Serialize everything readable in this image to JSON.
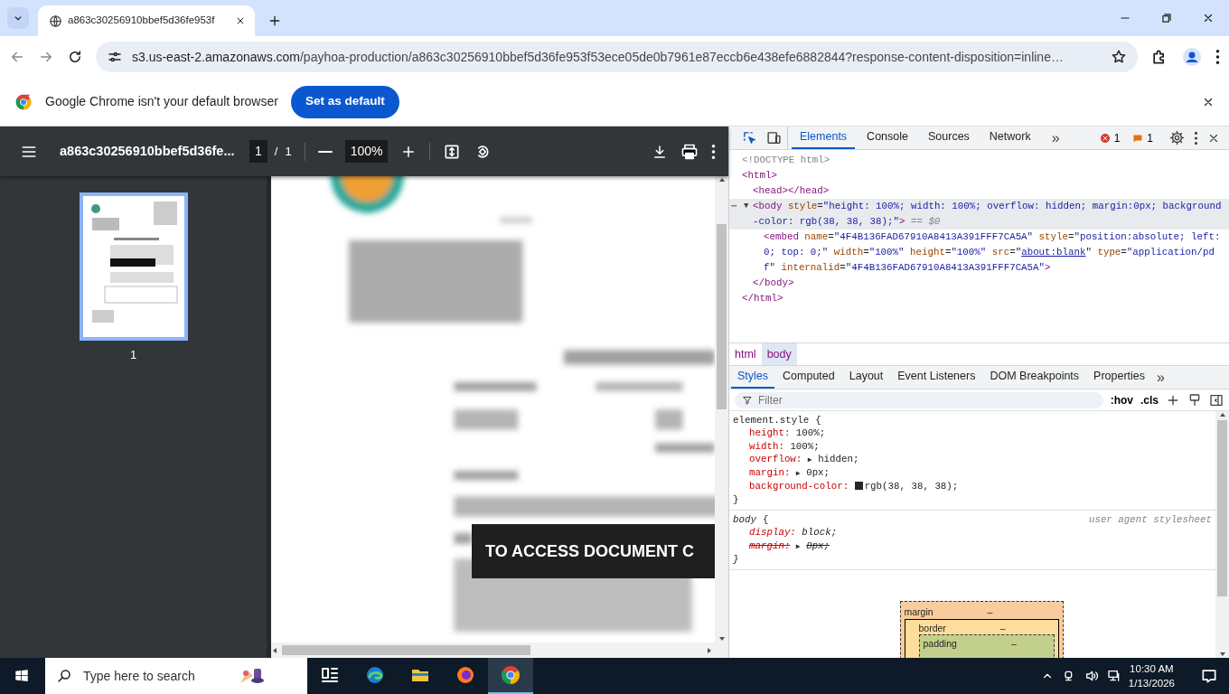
{
  "browser": {
    "tabs": [
      {
        "title": "a863c30256910bbef5d36fe953f",
        "selected": true
      }
    ],
    "address": {
      "host": "s3.us-east-2.amazonaws.com",
      "path": "/payhoa-production/a863c30256910bbef5d36fe953f53ece05de0b7961e87eccb6e438efe6882844?response-content-disposition=inline…"
    }
  },
  "infobar": {
    "message": "Google Chrome isn't your default browser",
    "button": "Set as default"
  },
  "pdf_viewer": {
    "title": "a863c30256910bbef5d36fe...",
    "page": "1",
    "page_separator": "/",
    "page_count": "1",
    "zoom": "100%",
    "thumbnails": [
      {
        "label": "1",
        "selected": true
      }
    ],
    "banner": "TO ACCESS DOCUMENT C"
  },
  "devtools": {
    "tabs": [
      {
        "label": "Elements",
        "selected": true
      },
      {
        "label": "Console",
        "selected": false
      },
      {
        "label": "Sources",
        "selected": false
      },
      {
        "label": "Network",
        "selected": false
      }
    ],
    "more_tabs": "»",
    "errors": "1",
    "warnings": "1",
    "dom_tree": [
      {
        "selected": false,
        "segments": [
          {
            "kind": "comment",
            "text": "<!DOCTYPE html>"
          }
        ]
      },
      {
        "selected": false,
        "segments": [
          {
            "kind": "tag",
            "text": "<html>"
          }
        ],
        "close": "</html>",
        "children": [
          {
            "selected": false,
            "segments": [
              {
                "kind": "tag",
                "text": "<head></head>"
              }
            ]
          },
          {
            "selected": true,
            "more": "⋯",
            "toggle": "▼",
            "segments": [
              {
                "kind": "tag",
                "text": "<body"
              },
              {
                "kind": "attr",
                "text": " style"
              },
              {
                "kind": "punct",
                "text": "="
              },
              {
                "kind": "value",
                "text": "\"height: 100%; width: 100%; overflow: hidden; margin:0px; background-color: rgb(38, 38, 38);\""
              },
              {
                "kind": "tag",
                "text": ">"
              },
              {
                "kind": "marker",
                "text": " == $0"
              }
            ],
            "close": "</body>",
            "children": [
              {
                "selected": false,
                "segments": [
                  {
                    "kind": "tag",
                    "text": "<embed"
                  },
                  {
                    "kind": "attr",
                    "text": " name"
                  },
                  {
                    "kind": "punct",
                    "text": "="
                  },
                  {
                    "kind": "value",
                    "text": "\"4F4B136FAD67910A8413A391FFF7CA5A\""
                  },
                  {
                    "kind": "attr",
                    "text": " style"
                  },
                  {
                    "kind": "punct",
                    "text": "="
                  },
                  {
                    "kind": "value",
                    "text": "\"position:absolute; left: 0; top: 0;\""
                  },
                  {
                    "kind": "attr",
                    "text": " width"
                  },
                  {
                    "kind": "punct",
                    "text": "="
                  },
                  {
                    "kind": "value",
                    "text": "\"100%\""
                  },
                  {
                    "kind": "attr",
                    "text": " height"
                  },
                  {
                    "kind": "punct",
                    "text": "="
                  },
                  {
                    "kind": "value",
                    "text": "\"100%\""
                  },
                  {
                    "kind": "attr",
                    "text": " src"
                  },
                  {
                    "kind": "punct",
                    "text": "=\""
                  },
                  {
                    "kind": "link",
                    "text": "about:blank"
                  },
                  {
                    "kind": "punct",
                    "text": "\""
                  },
                  {
                    "kind": "attr",
                    "text": " type"
                  },
                  {
                    "kind": "punct",
                    "text": "="
                  },
                  {
                    "kind": "value",
                    "text": "\"application/pdf\""
                  },
                  {
                    "kind": "attr",
                    "text": " internalid"
                  },
                  {
                    "kind": "punct",
                    "text": "="
                  },
                  {
                    "kind": "value",
                    "text": "\"4F4B136FAD67910A8413A391FFF7CA5A\""
                  },
                  {
                    "kind": "tag",
                    "text": ">"
                  }
                ]
              }
            ]
          }
        ]
      }
    ],
    "breadcrumbs": [
      {
        "label": "html",
        "selected": false
      },
      {
        "label": "body",
        "selected": true
      }
    ],
    "panel_tabs": [
      {
        "label": "Styles",
        "selected": true
      },
      {
        "label": "Computed",
        "selected": false
      },
      {
        "label": "Layout",
        "selected": false
      },
      {
        "label": "Event Listeners",
        "selected": false
      },
      {
        "label": "DOM Breakpoints",
        "selected": false
      },
      {
        "label": "Properties",
        "selected": false
      }
    ],
    "panel_more": "»",
    "filter": {
      "placeholder": "Filter"
    },
    "style_buttons": [
      ":hov",
      ".cls"
    ],
    "rules": [
      {
        "selector": "element.style",
        "open": "{",
        "close": "}",
        "italic": false,
        "declarations": [
          {
            "name": "height",
            "colon": ":",
            "value": "100%;",
            "overridden": false
          },
          {
            "name": "width",
            "colon": ":",
            "value": "100%;",
            "overridden": false
          },
          {
            "name": "overflow",
            "colon": ":",
            "toggle": "▶",
            "value": "hidden;",
            "overridden": false
          },
          {
            "name": "margin",
            "colon": ":",
            "toggle": "▶",
            "value": "0px;",
            "overridden": false
          },
          {
            "name": "background-color",
            "colon": ":",
            "color": "#262626",
            "value": "rgb(38, 38, 38);",
            "overridden": false
          }
        ]
      },
      {
        "selector": "body",
        "open": "{",
        "close": "}",
        "italic": true,
        "source": "user agent stylesheet",
        "declarations": [
          {
            "name": "display",
            "colon": ":",
            "value": "block;",
            "overridden": false
          },
          {
            "name": "margin",
            "colon": ":",
            "toggle": "▶",
            "value": "8px;",
            "overridden": true
          }
        ]
      }
    ],
    "box_model": [
      {
        "label": "margin",
        "value": "–"
      },
      {
        "label": "border",
        "value": "–"
      },
      {
        "label": "padding",
        "value": "–"
      }
    ]
  },
  "taskbar": {
    "search": {
      "placeholder": "Type here to search"
    },
    "apps": [
      {
        "kind": "taskview",
        "selected": false
      },
      {
        "kind": "edge",
        "selected": false
      },
      {
        "kind": "explorer",
        "selected": false
      },
      {
        "kind": "firefox",
        "selected": false
      },
      {
        "kind": "chrome",
        "selected": true
      }
    ],
    "time": "10:30 AM",
    "date": "1/13/2026"
  }
}
